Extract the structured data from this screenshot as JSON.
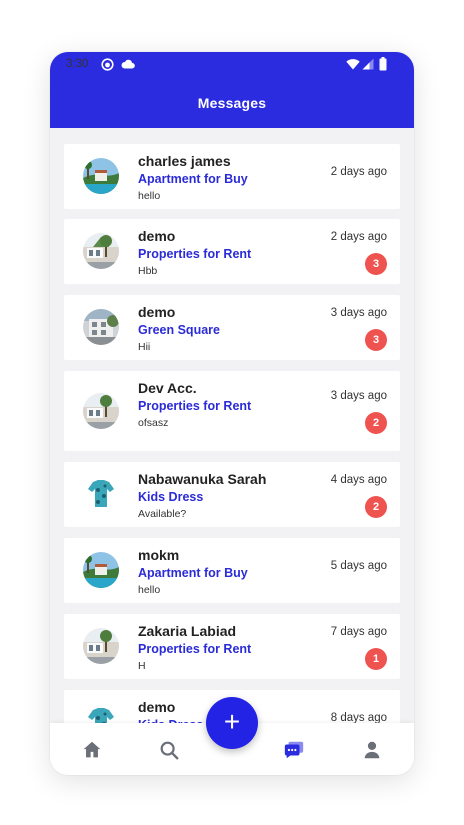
{
  "status_bar": {
    "time": "3:30"
  },
  "header": {
    "title": "Messages"
  },
  "conversations": [
    {
      "name": "charles james",
      "property": "Apartment for Buy",
      "message": "hello",
      "time": "2 days ago",
      "unread": ""
    },
    {
      "name": "demo",
      "property": "Properties for Rent",
      "message": "Hbb",
      "time": "2 days ago",
      "unread": "3"
    },
    {
      "name": "demo",
      "property": "Green Square",
      "message": "Hii",
      "time": "3 days ago",
      "unread": "3"
    },
    {
      "name": "Dev Acc.",
      "property": "Properties for Rent",
      "message": "ofsasz",
      "time": "3 days ago",
      "unread": "2"
    },
    {
      "name": "Nabawanuka Sarah",
      "property": "Kids Dress",
      "message": "Available?",
      "time": "4 days ago",
      "unread": "2"
    },
    {
      "name": "mokm",
      "property": "Apartment for Buy",
      "message": "hello",
      "time": "5 days ago",
      "unread": ""
    },
    {
      "name": "Zakaria Labiad",
      "property": "Properties for Rent",
      "message": "H",
      "time": "7 days ago",
      "unread": "1"
    },
    {
      "name": "demo",
      "property": "Kids Dress",
      "message": "",
      "time": "8 days ago",
      "unread": ""
    }
  ],
  "fab": {
    "label": "+"
  },
  "bottom_nav": {
    "items": [
      "home-icon",
      "search-icon",
      "chat-icon",
      "profile-icon"
    ],
    "active": "chat-icon"
  },
  "colors": {
    "primary": "#2b2be0",
    "badge": "#ef5350",
    "link": "#2b2bd8",
    "background": "#f2f2f4"
  }
}
